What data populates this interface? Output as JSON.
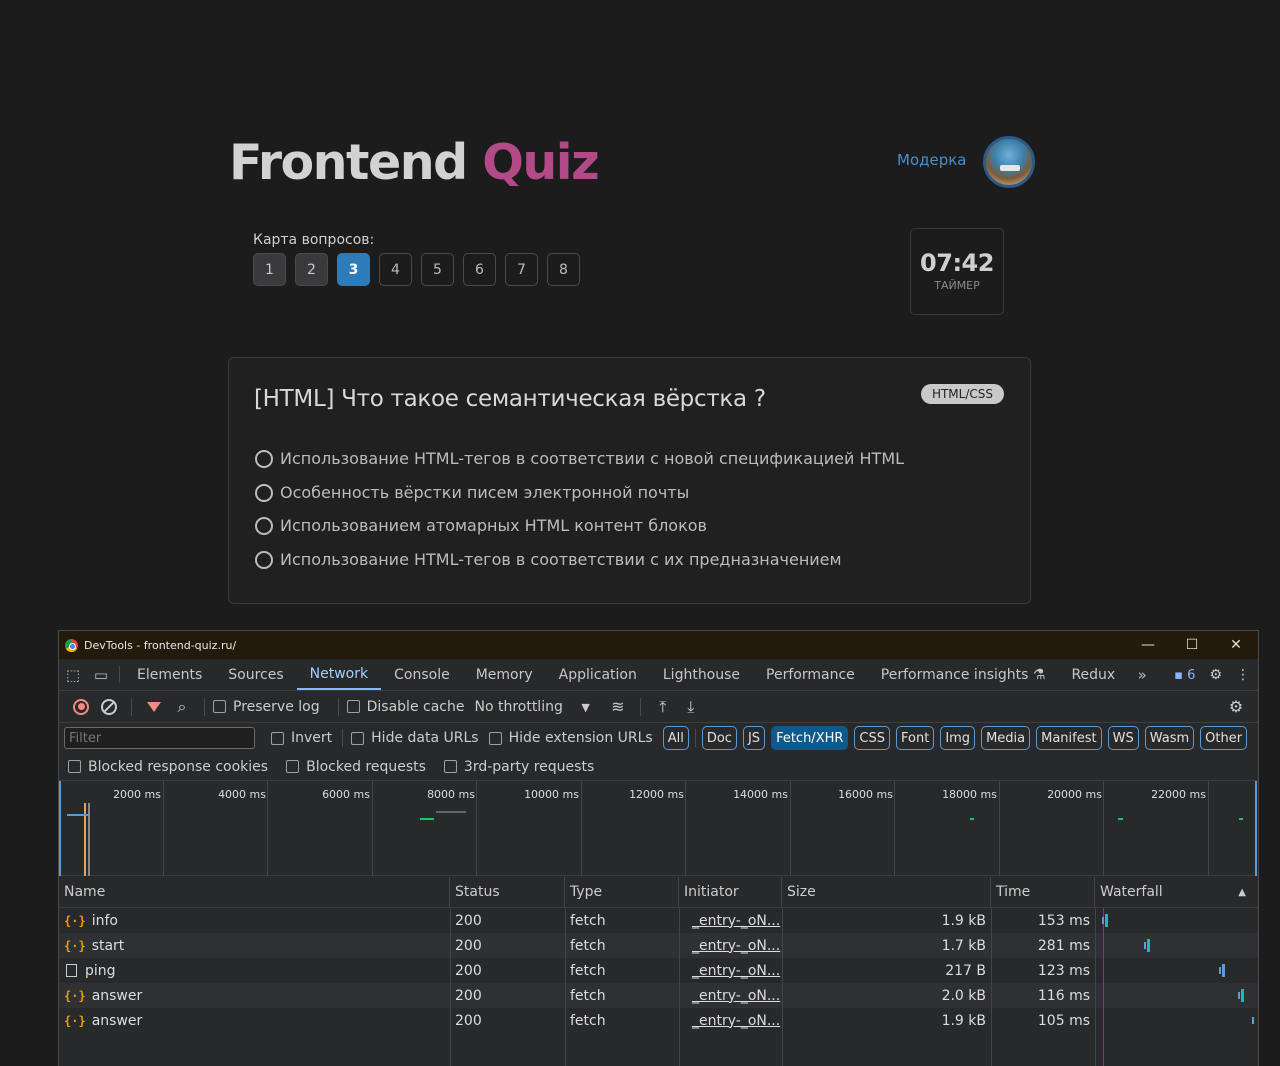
{
  "header": {
    "logo_word1": "Frontend",
    "logo_word2": "Quiz",
    "moderka_link": "Модерка"
  },
  "quiz": {
    "map_label": "Карта вопросов:",
    "questions": [
      "1",
      "2",
      "3",
      "4",
      "5",
      "6",
      "7",
      "8"
    ],
    "current_question": 3,
    "timer_value": "07:42",
    "timer_label": "ТАЙМЕР",
    "question_title": "[HTML] Что такое семантическая вёрстка ?",
    "tag": "HTML/CSS",
    "options": [
      "Использование HTML-тегов в соответствии с новой спецификацией HTML",
      "Особенность вёрстки писем электронной почты",
      "Использованием атомарных HTML контент блоков",
      "Использование HTML-тегов в соответствии с их предназначением"
    ]
  },
  "devtools": {
    "window_title": "DevTools - frontend-quiz.ru/",
    "tabs": [
      "Elements",
      "Sources",
      "Network",
      "Console",
      "Memory",
      "Application",
      "Lighthouse",
      "Performance",
      "Performance insights",
      "Redux"
    ],
    "active_tab": "Network",
    "issues_count": "6",
    "toolbar": {
      "preserve_log": "Preserve log",
      "disable_cache": "Disable cache",
      "throttling": "No throttling"
    },
    "filter": {
      "placeholder": "Filter",
      "invert": "Invert",
      "hide_data_urls": "Hide data URLs",
      "hide_extension_urls": "Hide extension URLs",
      "types": [
        "All",
        "Doc",
        "JS",
        "Fetch/XHR",
        "CSS",
        "Font",
        "Img",
        "Media",
        "Manifest",
        "WS",
        "Wasm",
        "Other"
      ],
      "active_type": "Fetch/XHR",
      "blocked_response_cookies": "Blocked response cookies",
      "blocked_requests": "Blocked requests",
      "third_party": "3rd-party requests"
    },
    "overview_ticks": [
      "2000 ms",
      "4000 ms",
      "6000 ms",
      "8000 ms",
      "10000 ms",
      "12000 ms",
      "14000 ms",
      "16000 ms",
      "18000 ms",
      "20000 ms",
      "22000 ms"
    ],
    "columns": {
      "name": "Name",
      "status": "Status",
      "type": "Type",
      "initiator": "Initiator",
      "size": "Size",
      "time": "Time",
      "waterfall": "Waterfall"
    },
    "requests": [
      {
        "name": "info",
        "kind": "fetch",
        "status": "200",
        "type": "fetch",
        "initiator": "_entry-_oN...",
        "size": "1.9 kB",
        "time": "153 ms"
      },
      {
        "name": "start",
        "kind": "fetch",
        "status": "200",
        "type": "fetch",
        "initiator": "_entry-_oN...",
        "size": "1.7 kB",
        "time": "281 ms"
      },
      {
        "name": "ping",
        "kind": "doc",
        "status": "200",
        "type": "fetch",
        "initiator": "_entry-_oN...",
        "size": "217 B",
        "time": "123 ms"
      },
      {
        "name": "answer",
        "kind": "fetch",
        "status": "200",
        "type": "fetch",
        "initiator": "_entry-_oN...",
        "size": "2.0 kB",
        "time": "116 ms"
      },
      {
        "name": "answer",
        "kind": "fetch",
        "status": "200",
        "type": "fetch",
        "initiator": "_entry-_oN...",
        "size": "1.9 kB",
        "time": "105 ms"
      }
    ]
  }
}
